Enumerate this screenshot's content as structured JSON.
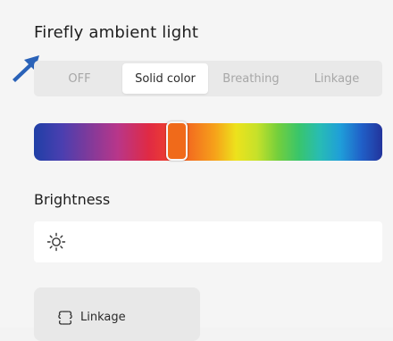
{
  "ambient_light": {
    "title": "Firefly ambient light",
    "modes": [
      {
        "label": "OFF",
        "active": false
      },
      {
        "label": "Solid color",
        "active": true
      },
      {
        "label": "Breathing",
        "active": false
      },
      {
        "label": "Linkage",
        "active": false
      }
    ],
    "color_slider": {
      "selected_color": "#f06a1a"
    }
  },
  "brightness": {
    "label": "Brightness",
    "icon": "sun-icon"
  },
  "linkage_card": {
    "label": "Linkage",
    "icon": "linkage-icon"
  },
  "colors": {
    "accent_arrow": "#2a62b8",
    "background": "#f5f5f5",
    "segment_background": "#e9e9e9"
  }
}
